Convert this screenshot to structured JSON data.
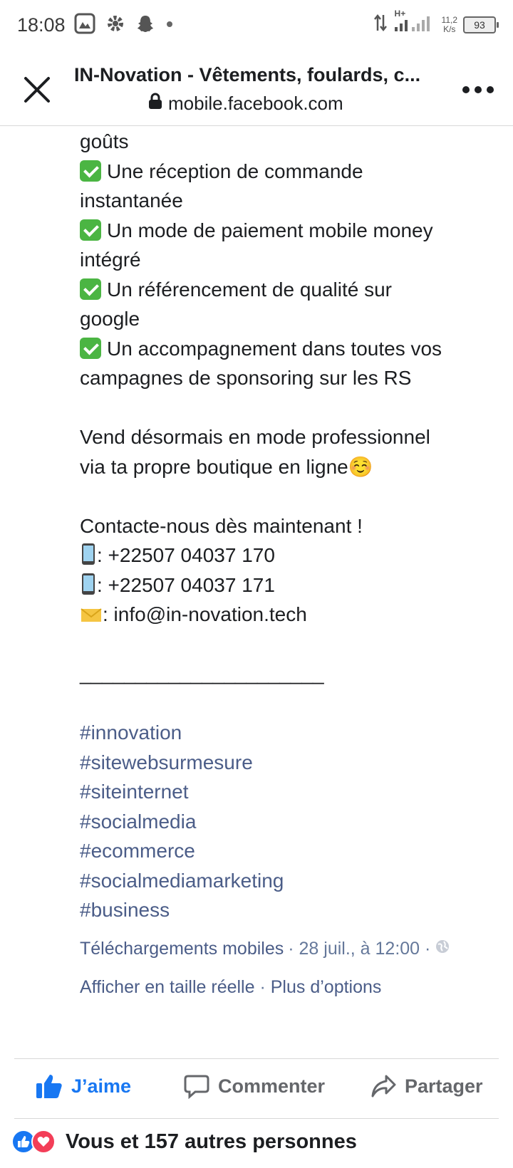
{
  "status_bar": {
    "time": "18:08",
    "network": "H+",
    "speed_value": "11,2",
    "speed_unit": "K/s",
    "battery": "93"
  },
  "header": {
    "title": "IN-Novation - Vêtements, foulards, c...",
    "url": "mobile.facebook.com"
  },
  "post": {
    "lines": {
      "gouts": "goûts",
      "reception_1": "Une réception de commande",
      "reception_2": "instantanée",
      "paiement_1": "Un mode de paiement mobile money",
      "paiement_2": "intégré",
      "referencement_1": "Un référencement de qualité sur",
      "referencement_2": "google",
      "accompagnement_1": "Un accompagnement dans toutes vos",
      "accompagnement_2": "campagnes de sponsoring sur les RS",
      "vend_1": "Vend désormais en mode professionnel",
      "vend_2": "via ta propre boutique en ligne☺️",
      "contact": "Contacte-nous dès maintenant !",
      "phone_1": ": +22507 04037 170",
      "phone_2": ": +22507 04037 171",
      "email": ": info@in-novation.tech",
      "separator": "______________________"
    },
    "hashtags": [
      "#innovation",
      "#sitewebsurmesure",
      "#siteinternet",
      "#socialmedia",
      "#ecommerce",
      "#socialmediamarketing",
      "#business"
    ],
    "meta": {
      "album": "Téléchargements mobiles",
      "date": "· 28 juil., à 12:00 ·",
      "view_full": "Afficher en taille réelle",
      "sep": "·",
      "more_options": "Plus d’options"
    }
  },
  "actions": {
    "like": "J’aime",
    "comment": "Commenter",
    "share": "Partager"
  },
  "reactions": {
    "text": "Vous et 157 autres personnes"
  },
  "colors": {
    "link": "#4b5d88",
    "like_blue": "#1877f2",
    "love_red": "#f33e58"
  }
}
